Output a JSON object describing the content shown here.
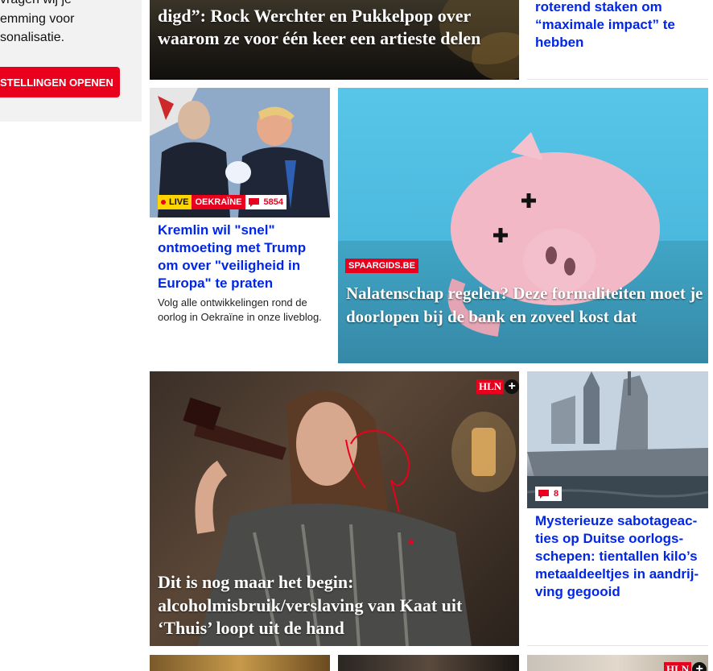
{
  "consent": {
    "text": "vragen wij je\nemming voor\nsonalisatie.",
    "button_label": "stellingen openen"
  },
  "top_feature": {
    "headline": "digd”: Rock Werchter en Pukkelpop over waarom ze voor één keer een artieste delen"
  },
  "top_right": {
    "headline": "roterend staken om “maximale impact” te hebben"
  },
  "kremlin": {
    "live_label": "LIVE",
    "tag": "OEKRAÏNE",
    "comments": "5854",
    "headline": "Kremlin wil \"snel\" ontmoeting met Trump om over \"veiligheid in Europa\" te praten",
    "summary": "Volg alle ontwikkelingen rond de oorlog in Oekraïne in onze liveblog."
  },
  "piggy": {
    "tag": "SPAARGIDS.BE",
    "headline": "Nalatenschap regelen? Deze formaliteiten moet je doorlopen bij de bank en zoveel kost dat"
  },
  "kaat": {
    "premium_label": "HLN",
    "headline": "Dit is nog maar het begin: alcoholmisbruik/verslaving van Kaat uit ‘Thuis’ loopt uit de hand"
  },
  "ships": {
    "comments": "8",
    "headline": "Mysterieuze sabotageac-ties op Duitse oorlogs-schepen: tientallen kilo’s metaaldeeltjes in aandrij-ving gegooid"
  },
  "bottom_right": {
    "premium_label": "HLN"
  },
  "colors": {
    "brand_red": "#e8001c",
    "link_blue": "#0026e6",
    "live_yellow": "#ffd500"
  }
}
